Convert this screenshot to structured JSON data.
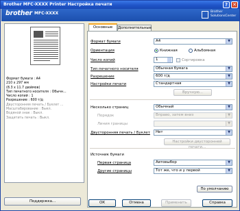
{
  "window": {
    "title": "Brother MFC-XXXX   Printer Настройка печати",
    "help_glyph": "?",
    "close_glyph": "✕"
  },
  "banner": {
    "brand": "brother",
    "model": "MFC-XXXX",
    "logo_line1": "Brother",
    "logo_line2": "SolutionsCenter"
  },
  "summary": [
    "Формат бумаги : A4",
    "210 x 297 мм",
    "(8.3 x 11.7 дюймов)",
    "Тип печатного носителя : Обычн...",
    "Число копий : 1",
    "Разрешение : 600 т/д",
    "Двусторонняя печать / Буклет ...",
    "Масштабирование : Выкл.",
    "Водяной знак : Выкл.",
    "Защитить печать : Выкл."
  ],
  "tabs": {
    "basic": "Основные",
    "advanced": "Дополнительные"
  },
  "basic": {
    "paper_size_label": "Формат бумаги",
    "paper_size_value": "A4",
    "orientation_label": "Ориентация",
    "portrait_label": "Книжная",
    "landscape_label": "Альбомная",
    "copies_label": "Число копий",
    "copies_value": "1",
    "collate_label": "Сортировка",
    "media_label": "Тип печатного носителя",
    "media_value": "Обычная бумага",
    "resolution_label": "Разрешение",
    "resolution_value": "600 т/д",
    "print_settings_label": "Настройки печати",
    "print_settings_value": "Стандартная",
    "manual_button": "Вручную...",
    "multipage_label": "Несколько страниц",
    "multipage_value": "Обычный",
    "page_order_label": "Порядок",
    "page_order_value": "Вправо, затем вниз",
    "border_label": "Линия границы",
    "duplex_label": "Двусторонняя печать / Буклет",
    "duplex_value": "Нет",
    "duplex_settings_button": "Настройки двусторонней печати...",
    "source_label": "Источник бумаги",
    "first_page_label": "Первая страница",
    "first_page_value": "Автовыбор",
    "other_pages_label": "Другие страницы",
    "other_pages_value": "Тот же, что и у первой",
    "default_button": "По умолчанию"
  },
  "footer": {
    "support": "Поддержка...",
    "ok": "ОК",
    "cancel": "Отмена",
    "apply": "Применить",
    "help": "Справка"
  }
}
